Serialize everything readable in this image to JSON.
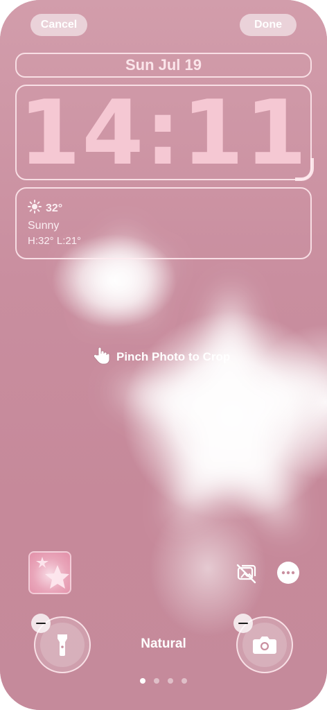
{
  "toolbar": {
    "cancel_label": "Cancel",
    "done_label": "Done"
  },
  "lock_screen": {
    "date": "Sun Jul 19",
    "time": "14:11"
  },
  "weather_widget": {
    "temperature": "32°",
    "condition": "Sunny",
    "range": "H:32° L:21°",
    "icon": "sun-icon"
  },
  "hint": {
    "text": "Pinch Photo to Crop",
    "icon": "pinch-hand-icon"
  },
  "bottom_controls": {
    "filter_name": "Natural",
    "left_shortcut_icon": "flashlight-icon",
    "right_shortcut_icon": "camera-icon",
    "page_count": 4,
    "active_page": 1
  },
  "colors": {
    "wallpaper_pink": "#c98f9f",
    "clock_pink": "#f5c8d3",
    "white": "#ffffff"
  }
}
